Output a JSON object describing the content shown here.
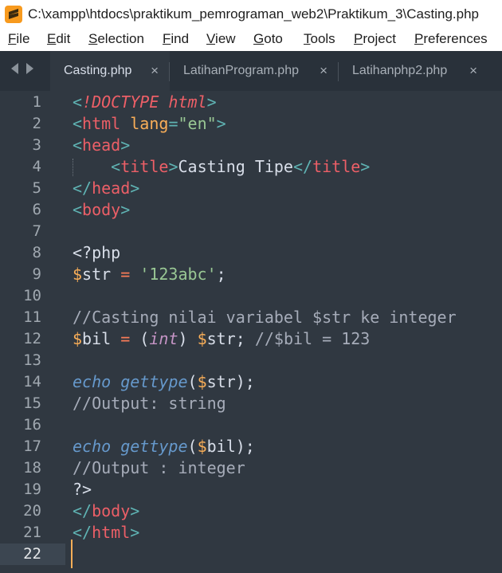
{
  "window": {
    "title": "C:\\xampp\\htdocs\\praktikum_pemrograman_web2\\Praktikum_3\\Casting.php"
  },
  "menu": [
    {
      "first": "F",
      "rest": "ile"
    },
    {
      "first": "E",
      "rest": "dit"
    },
    {
      "first": "S",
      "rest": "election"
    },
    {
      "first": "F",
      "rest": "ind"
    },
    {
      "first": "V",
      "rest": "iew"
    },
    {
      "first": "G",
      "rest": "oto"
    },
    {
      "first": "T",
      "rest": "ools"
    },
    {
      "first": "P",
      "rest": "roject"
    },
    {
      "first": "P",
      "rest": "references"
    }
  ],
  "tabs": [
    {
      "label": "Casting.php",
      "active": true,
      "close": "×"
    },
    {
      "label": "LatihanProgram.php",
      "active": false,
      "close": "×"
    },
    {
      "label": "Latihanphp2.php",
      "active": false,
      "close": "×"
    }
  ],
  "editor": {
    "active_line": 22,
    "lines": [
      {
        "n": "1",
        "tokens": [
          [
            "t-punct",
            "<"
          ],
          [
            "t-doctype",
            "!DOCTYPE html"
          ],
          [
            "t-punct",
            ">"
          ]
        ]
      },
      {
        "n": "2",
        "tokens": [
          [
            "t-punct",
            "<"
          ],
          [
            "t-tag",
            "html"
          ],
          [
            "t-plain",
            " "
          ],
          [
            "t-attr",
            "lang"
          ],
          [
            "t-punct",
            "="
          ],
          [
            "t-str",
            "\"en\""
          ],
          [
            "t-punct",
            ">"
          ]
        ]
      },
      {
        "n": "3",
        "tokens": [
          [
            "t-punct",
            "<"
          ],
          [
            "t-tag",
            "head"
          ],
          [
            "t-punct",
            ">"
          ]
        ]
      },
      {
        "n": "4",
        "tokens": [
          [
            "t-plain",
            "    "
          ],
          [
            "t-punct",
            "<"
          ],
          [
            "t-tag",
            "title"
          ],
          [
            "t-punct",
            ">"
          ],
          [
            "t-plain",
            "Casting Tipe"
          ],
          [
            "t-punct",
            "</"
          ],
          [
            "t-tag",
            "title"
          ],
          [
            "t-punct",
            ">"
          ]
        ],
        "indent": true
      },
      {
        "n": "5",
        "tokens": [
          [
            "t-punct",
            "</"
          ],
          [
            "t-tag",
            "head"
          ],
          [
            "t-punct",
            ">"
          ]
        ]
      },
      {
        "n": "6",
        "tokens": [
          [
            "t-punct",
            "<"
          ],
          [
            "t-tag",
            "body"
          ],
          [
            "t-punct",
            ">"
          ]
        ]
      },
      {
        "n": "7",
        "tokens": []
      },
      {
        "n": "8",
        "tokens": [
          [
            "t-plain",
            "<?php"
          ]
        ]
      },
      {
        "n": "9",
        "tokens": [
          [
            "t-var",
            "$"
          ],
          [
            "t-plain",
            "str "
          ],
          [
            "t-op",
            "="
          ],
          [
            "t-plain",
            " "
          ],
          [
            "t-str",
            "'123abc'"
          ],
          [
            "t-plain",
            ";"
          ]
        ]
      },
      {
        "n": "10",
        "tokens": []
      },
      {
        "n": "11",
        "tokens": [
          [
            "t-comment",
            "//Casting nilai variabel $str ke integer"
          ]
        ]
      },
      {
        "n": "12",
        "tokens": [
          [
            "t-var",
            "$"
          ],
          [
            "t-plain",
            "bil "
          ],
          [
            "t-op",
            "="
          ],
          [
            "t-plain",
            " ("
          ],
          [
            "t-cast",
            "int"
          ],
          [
            "t-plain",
            ") "
          ],
          [
            "t-var",
            "$"
          ],
          [
            "t-plain",
            "str; "
          ],
          [
            "t-comment",
            "//$bil = 123"
          ]
        ]
      },
      {
        "n": "13",
        "tokens": []
      },
      {
        "n": "14",
        "tokens": [
          [
            "t-kw",
            "echo"
          ],
          [
            "t-plain",
            " "
          ],
          [
            "t-kw",
            "gettype"
          ],
          [
            "t-plain",
            "("
          ],
          [
            "t-var",
            "$"
          ],
          [
            "t-plain",
            "str);"
          ]
        ]
      },
      {
        "n": "15",
        "tokens": [
          [
            "t-comment",
            "//Output: string"
          ]
        ]
      },
      {
        "n": "16",
        "tokens": []
      },
      {
        "n": "17",
        "tokens": [
          [
            "t-kw",
            "echo"
          ],
          [
            "t-plain",
            " "
          ],
          [
            "t-kw",
            "gettype"
          ],
          [
            "t-plain",
            "("
          ],
          [
            "t-var",
            "$"
          ],
          [
            "t-plain",
            "bil);"
          ]
        ]
      },
      {
        "n": "18",
        "tokens": [
          [
            "t-comment",
            "//Output : integer"
          ]
        ]
      },
      {
        "n": "19",
        "tokens": [
          [
            "t-plain",
            "?>"
          ]
        ]
      },
      {
        "n": "20",
        "tokens": [
          [
            "t-punct",
            "</"
          ],
          [
            "t-tag",
            "body"
          ],
          [
            "t-punct",
            ">"
          ]
        ]
      },
      {
        "n": "21",
        "tokens": [
          [
            "t-punct",
            "</"
          ],
          [
            "t-tag",
            "html"
          ],
          [
            "t-punct",
            ">"
          ]
        ]
      },
      {
        "n": "22",
        "tokens": []
      }
    ]
  },
  "colors": {
    "editor_bg": "#303841",
    "tabbar_bg": "#29313a",
    "caret": "#f9ae58",
    "logo": "#f79a1e"
  }
}
